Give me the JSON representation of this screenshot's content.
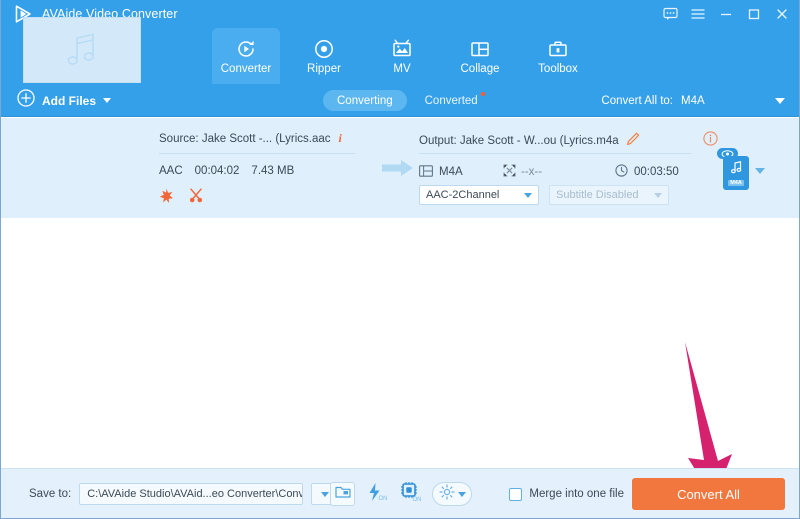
{
  "window": {
    "app_title": "AVAide Video Converter",
    "logo_icon": "play-triangle-logo",
    "controls": [
      {
        "name": "feedback-icon",
        "glyph": "speech-bubble"
      },
      {
        "name": "menu-icon",
        "glyph": "hamburger"
      },
      {
        "name": "minimize-icon",
        "glyph": "minimize"
      },
      {
        "name": "maximize-icon",
        "glyph": "maximize"
      },
      {
        "name": "close-icon",
        "glyph": "close"
      }
    ]
  },
  "nav": {
    "tabs": [
      {
        "label": "Converter",
        "icon": "convert-circular-arrow-icon",
        "active": true
      },
      {
        "label": "Ripper",
        "icon": "disc-icon",
        "active": false
      },
      {
        "label": "MV",
        "icon": "picture-frame-icon",
        "active": false
      },
      {
        "label": "Collage",
        "icon": "layout-grid-icon",
        "active": false
      },
      {
        "label": "Toolbox",
        "icon": "toolbox-icon",
        "active": false
      }
    ]
  },
  "actionbar": {
    "add_files_label": "Add Files",
    "add_files_icon": "plus-circle-icon",
    "segments": [
      {
        "label": "Converting",
        "active": true,
        "badge": false
      },
      {
        "label": "Converted",
        "active": false,
        "badge": true
      }
    ],
    "convert_all_to_label": "Convert All to:",
    "convert_all_to_value": "M4A"
  },
  "file_item": {
    "thumbnail_icon": "music-note-icon",
    "source": {
      "label": "Source: Jake Scott -... (Lyrics.aac",
      "info_icon": "info-italic-icon",
      "format": "AAC",
      "duration": "00:04:02",
      "size": "7.43 MB",
      "tools": [
        {
          "name": "magic-wand-edit-icon"
        },
        {
          "name": "scissors-cut-icon"
        }
      ]
    },
    "transfer_icon": "right-arrow-icon",
    "output": {
      "label": "Output: Jake Scott - W...ou (Lyrics.m4a",
      "edit_icon": "pencil-edit-icon",
      "info_icon": "info-circle-icon",
      "format": "M4A",
      "format_icon": "film-strip-icon",
      "resolution": "--x--",
      "resolution_icon": "resize-icon",
      "duration": "00:03:50",
      "duration_icon": "clock-icon",
      "audio_track": "AAC-2Channel",
      "subtitle_track": "Subtitle Disabled",
      "preview_badge_icon": "eye-preview-icon",
      "preview_thumb_label": "M4A",
      "preview_thumb_icon": "audio-file-icon"
    }
  },
  "bottombar": {
    "save_to_label": "Save to:",
    "save_to_path": "C:\\AVAide Studio\\AVAid...eo Converter\\Converted",
    "tools": [
      {
        "name": "open-folder-icon",
        "state": ""
      },
      {
        "name": "hardware-acceleration-icon",
        "state": "ON"
      },
      {
        "name": "gpu-chip-icon",
        "state": "ON"
      },
      {
        "name": "settings-gear-icon",
        "state": ""
      }
    ],
    "merge_label": "Merge into one file",
    "merge_checked": false,
    "convert_button_label": "Convert All"
  },
  "annotation": {
    "arrow_name": "pointer-arrow-to-convert-all",
    "color": "#d6216e"
  },
  "colors": {
    "titlebar_blue": "#35a0ea",
    "active_tab_blue": "#4aadef",
    "file_row_blue": "#dfeffc",
    "bottom_bar_blue": "#e4f1fc",
    "convert_orange": "#f2773f",
    "accent_orange": "#f26a3d",
    "annotation_pink": "#d6216e"
  }
}
